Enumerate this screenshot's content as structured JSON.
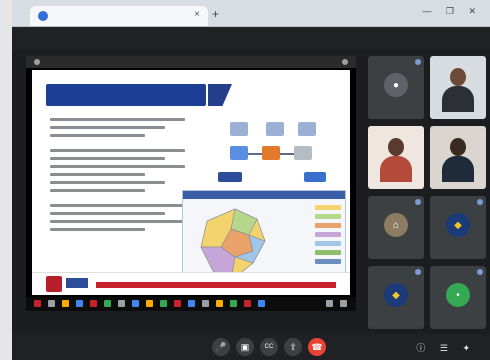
{
  "browser": {
    "tab_title": "",
    "tab_close_icon": "×",
    "new_tab_icon": "+",
    "window_controls": "— ❐ ✕"
  },
  "meeting": {
    "title": "",
    "time": ""
  },
  "slide": {
    "title": ""
  },
  "participants": [
    {
      "name": "",
      "type": "avatar",
      "color": "#5f6368",
      "icon": "person-icon"
    },
    {
      "name": "",
      "type": "camera",
      "color": "#d7dce0"
    },
    {
      "name": "",
      "type": "camera",
      "color": "#f0e6e0"
    },
    {
      "name": "",
      "type": "camera",
      "color": "#dad5cf"
    },
    {
      "name": "",
      "type": "avatar",
      "color": "#8b7c62",
      "icon": "house-icon"
    },
    {
      "name": "",
      "type": "avatar",
      "color": "#1a3a7a",
      "icon": "logo-icon"
    },
    {
      "name": "",
      "type": "avatar",
      "color": "#1a3a7a",
      "icon": "logo-icon"
    },
    {
      "name": "",
      "type": "avatar",
      "color": "#34a853",
      "icon": "letter-icon"
    }
  ],
  "colors": {
    "slide_title_bar": "#1c3f94",
    "footer_bar": "#c8232c",
    "end_call": "#ea4335",
    "control_button": "#3c4043"
  },
  "controls": {
    "mic_icon": "🎤",
    "camera_icon": "▣",
    "captions_icon": "CC",
    "present_icon": "⇧",
    "end_call_icon": "☎",
    "right_icons": "ⓘ ☰ ✦"
  }
}
